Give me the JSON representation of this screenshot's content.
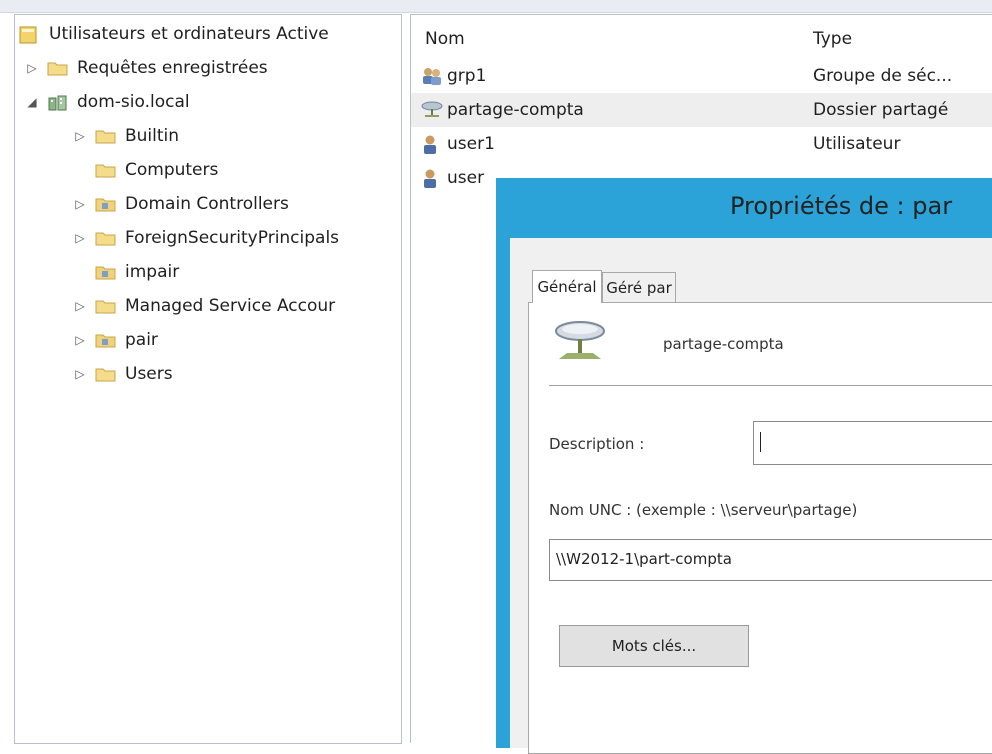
{
  "tree": {
    "root_label": "Utilisateurs et ordinateurs Active",
    "items": [
      {
        "label": "Requêtes enregistrées",
        "expander": "▷"
      },
      {
        "label": "dom-sio.local",
        "expander": "◢"
      },
      {
        "label": "Builtin",
        "expander": "▷"
      },
      {
        "label": "Computers",
        "expander": ""
      },
      {
        "label": "Domain Controllers",
        "expander": "▷"
      },
      {
        "label": "ForeignSecurityPrincipals",
        "expander": "▷"
      },
      {
        "label": "impair",
        "expander": ""
      },
      {
        "label": "Managed Service Accour",
        "expander": "▷"
      },
      {
        "label": "pair",
        "expander": "▷"
      },
      {
        "label": "Users",
        "expander": "▷"
      }
    ]
  },
  "list": {
    "columns": {
      "name": "Nom",
      "type": "Type"
    },
    "rows": [
      {
        "name": "grp1",
        "type": "Groupe de séc...",
        "icon": "group-icon"
      },
      {
        "name": "partage-compta",
        "type": "Dossier partagé",
        "icon": "shared-folder-icon"
      },
      {
        "name": "user1",
        "type": "Utilisateur",
        "icon": "user-icon"
      },
      {
        "name": "user",
        "type": "",
        "icon": "user-icon"
      }
    ]
  },
  "dialog": {
    "title": "Propriétés de : par",
    "tabs": [
      "Général",
      "Géré par"
    ],
    "object_name": "partage-compta",
    "description_label": "Description :",
    "description_value": "",
    "unc_label": "Nom UNC : (exemple : \\\\serveur\\partage)",
    "unc_value": "\\\\W2012-1\\part-compta",
    "keywords_button": "Mots clés..."
  },
  "colors": {
    "dialog_frame": "#2ba3d8",
    "folder": "#f0d27a",
    "selection": "#eeeeee"
  }
}
